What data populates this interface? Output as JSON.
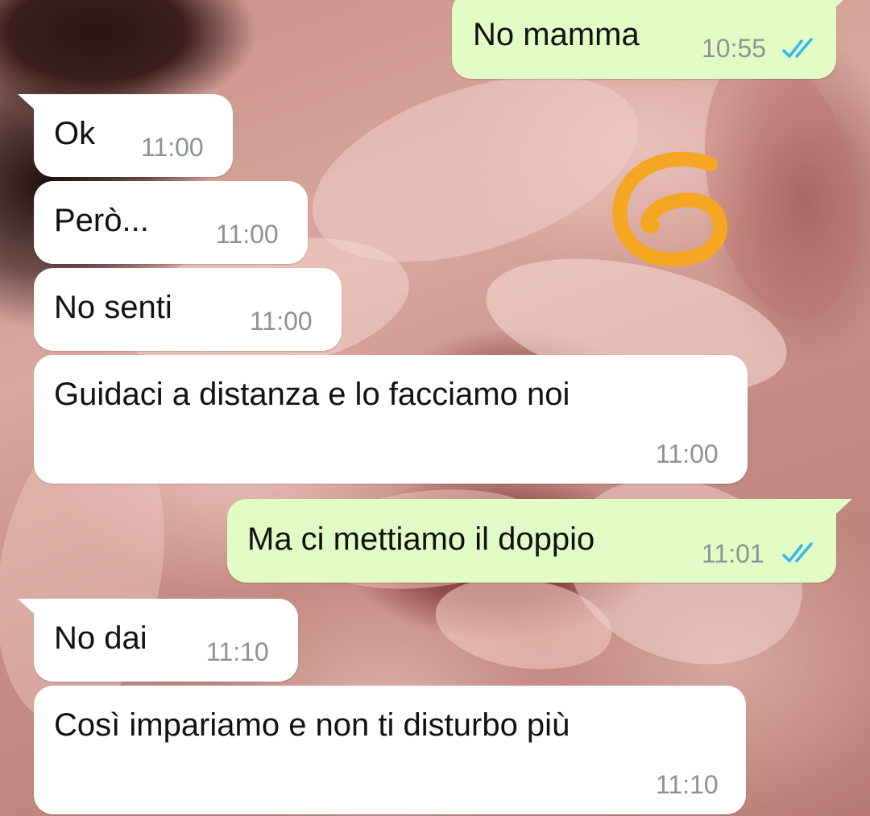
{
  "messages": [
    {
      "id": "m1",
      "direction": "outgoing",
      "text": "No mamma",
      "time": "10:55",
      "status": "read"
    },
    {
      "id": "m2",
      "direction": "incoming",
      "text": "Ok",
      "time": "11:00"
    },
    {
      "id": "m3",
      "direction": "incoming",
      "text": "Però...",
      "time": "11:00"
    },
    {
      "id": "m4",
      "direction": "incoming",
      "text": "No senti",
      "time": "11:00"
    },
    {
      "id": "m5",
      "direction": "incoming",
      "text": "Guidaci a distanza e lo facciamo noi",
      "time": "11:00"
    },
    {
      "id": "m6",
      "direction": "outgoing",
      "text": "Ma ci mettiamo il doppio",
      "time": "11:01",
      "status": "read"
    },
    {
      "id": "m7",
      "direction": "incoming",
      "text": "No dai",
      "time": "11:10"
    },
    {
      "id": "m8",
      "direction": "incoming",
      "text": "Così impariamo e non ti disturbo più",
      "time": "11:10"
    }
  ],
  "icons": {
    "read_receipt": "double-check-icon",
    "annotation": "hand-drawn-number-six"
  },
  "colors": {
    "incoming_bubble": "#ffffff",
    "outgoing_bubble": "#e2fcc6",
    "timestamp": "#8c9196",
    "read_ticks": "#34b7f1",
    "annotation": "#f5a623"
  }
}
